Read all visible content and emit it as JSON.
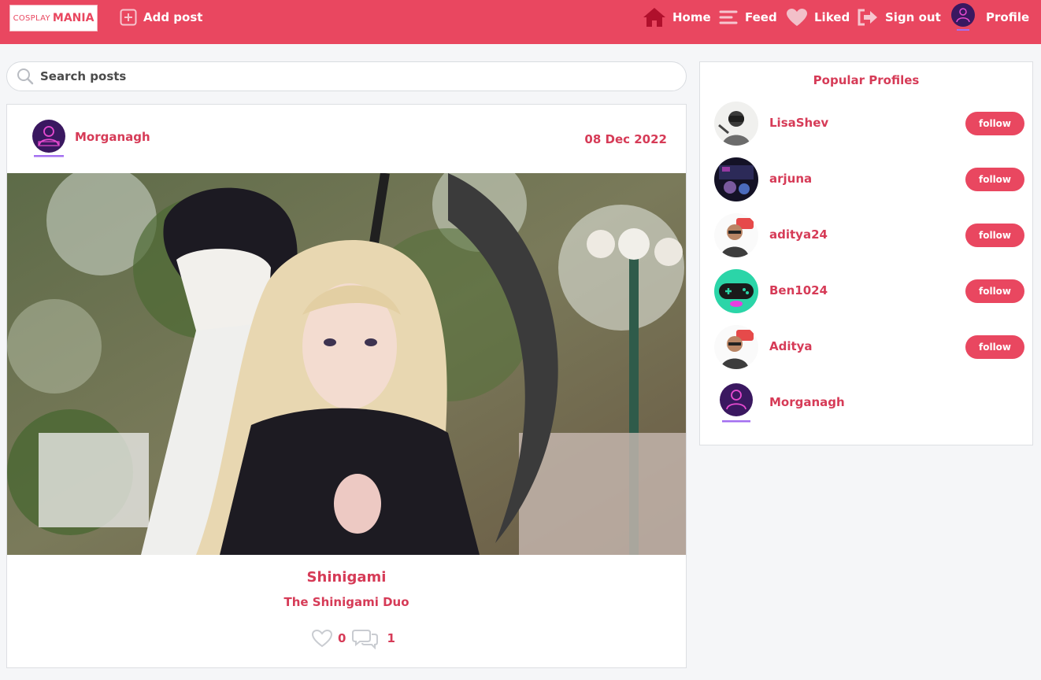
{
  "nav": {
    "logo_part1": "COSPLAY",
    "logo_part2": "MANIA",
    "add_post": "Add post",
    "home": "Home",
    "feed": "Feed",
    "liked": "Liked",
    "sign_out": "Sign out",
    "profile": "Profile"
  },
  "search": {
    "placeholder": "Search posts"
  },
  "post": {
    "author": "Morganagh",
    "date": "08 Dec 2022",
    "title": "Shinigami",
    "subtitle": "The Shinigami Duo",
    "likes": "0",
    "comments": "1"
  },
  "sidebar": {
    "title": "Popular Profiles",
    "profiles": [
      {
        "name": "LisaShev",
        "follow": "follow"
      },
      {
        "name": "arjuna",
        "follow": "follow"
      },
      {
        "name": "aditya24",
        "follow": "follow"
      },
      {
        "name": "Ben1024",
        "follow": "follow"
      },
      {
        "name": "Aditya",
        "follow": "follow"
      },
      {
        "name": "Morganagh"
      }
    ]
  },
  "colors": {
    "accent": "#e94760",
    "text_accent": "#d63b57"
  }
}
